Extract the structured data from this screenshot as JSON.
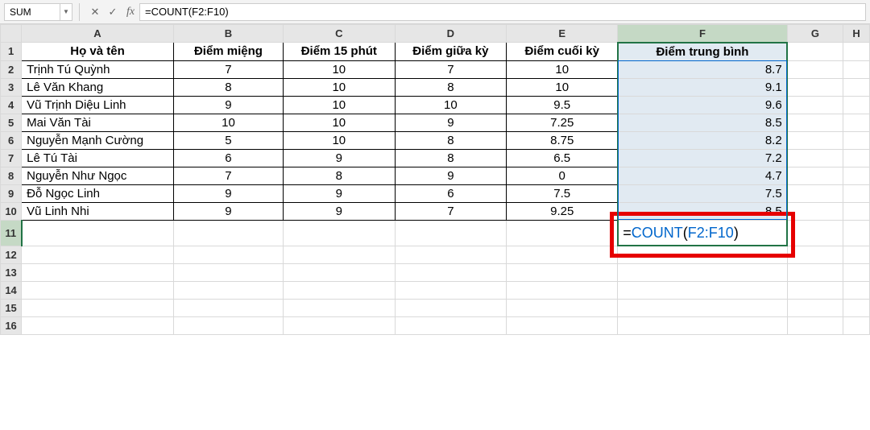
{
  "nameBox": "SUM",
  "formulaBar": "=COUNT(F2:F10)",
  "columns": [
    "A",
    "B",
    "C",
    "D",
    "E",
    "F",
    "G",
    "H"
  ],
  "headers": {
    "A": "Họ và tên",
    "B": "Điểm miệng",
    "C": "Điểm 15 phút",
    "D": "Điểm giữa kỳ",
    "E": "Điểm cuối kỳ",
    "F": "Điểm trung bình"
  },
  "rows": [
    {
      "n": 2,
      "A": "Trịnh Tú Quỳnh",
      "B": "7",
      "C": "10",
      "D": "7",
      "E": "10",
      "F": "8.7"
    },
    {
      "n": 3,
      "A": "Lê Văn Khang",
      "B": "8",
      "C": "10",
      "D": "8",
      "E": "10",
      "F": "9.1"
    },
    {
      "n": 4,
      "A": "Vũ Trịnh Diệu Linh",
      "B": "9",
      "C": "10",
      "D": "10",
      "E": "9.5",
      "F": "9.6"
    },
    {
      "n": 5,
      "A": "Mai Văn Tài",
      "B": "10",
      "C": "10",
      "D": "9",
      "E": "7.25",
      "F": "8.5"
    },
    {
      "n": 6,
      "A": "Nguyễn Mạnh Cường",
      "B": "5",
      "C": "10",
      "D": "8",
      "E": "8.75",
      "F": "8.2"
    },
    {
      "n": 7,
      "A": "Lê Tú Tài",
      "B": "6",
      "C": "9",
      "D": "8",
      "E": "6.5",
      "F": "7.2"
    },
    {
      "n": 8,
      "A": "Nguyễn Như Ngọc",
      "B": "7",
      "C": "8",
      "D": "9",
      "E": "0",
      "F": "4.7"
    },
    {
      "n": 9,
      "A": "Đỗ Ngọc Linh",
      "B": "9",
      "C": "9",
      "D": "6",
      "E": "7.5",
      "F": "7.5"
    },
    {
      "n": 10,
      "A": "Vũ Linh Nhi",
      "B": "9",
      "C": "9",
      "D": "7",
      "E": "9.25",
      "F": "8.5"
    }
  ],
  "emptyRows": [
    11,
    12,
    13,
    14,
    15,
    16
  ],
  "activeFormula": {
    "prefix": "=",
    "fn": "COUNT",
    "open": "(",
    "ref": "F2:F10",
    "close": ")"
  },
  "selectedCol": "F",
  "selectedRow": 11
}
